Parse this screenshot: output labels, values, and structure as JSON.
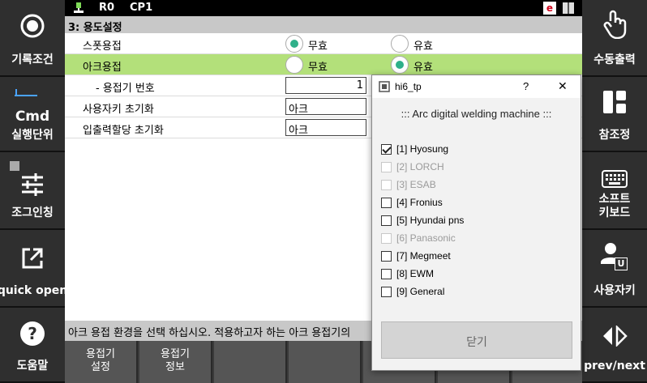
{
  "topbar": {
    "robot": "R0",
    "program": "CP1",
    "e_badge": "e"
  },
  "left_menu": {
    "recording": "기록조건",
    "cmd": "Cmd",
    "exec_unit": "실행단위",
    "jogging": "조그인칭",
    "quick_open": "quick open",
    "help": "도움말"
  },
  "right_menu": {
    "manual_output": "수동출력",
    "reference": "참조정",
    "soft_kb_1": "소프트",
    "soft_kb_2": "키보드",
    "user_key": "사용자키",
    "prev_next": "prev/next",
    "user_badge": "U"
  },
  "main": {
    "title": "3: 용도설정",
    "rows": [
      {
        "name": "스폿용접",
        "opt1": "무효",
        "opt2": "유효"
      },
      {
        "name": "아크용접",
        "opt1": "무효",
        "opt2": "유효"
      },
      {
        "name": "- 용접기 번호",
        "value": "1"
      },
      {
        "name": "사용자키 초기화",
        "value": "아크"
      },
      {
        "name": "입출력할당 초기화",
        "value": "아크"
      }
    ]
  },
  "status_text": "아크 용접 환경을 선택 하십시오.  적용하고자 하는 아크 용접기의",
  "fkeys": {
    "f1_l1": "용접기",
    "f1_l2": "설정",
    "f2_l1": "용접기",
    "f2_l2": "정보"
  },
  "dialog": {
    "title": "hi6_tp",
    "help": "?",
    "close": "✕",
    "heading": "::: Arc digital welding machine :::",
    "options": [
      {
        "label": "[1] Hyosung",
        "checked": true,
        "enabled": true
      },
      {
        "label": "[2] LORCH",
        "checked": false,
        "enabled": false
      },
      {
        "label": "[3] ESAB",
        "checked": false,
        "enabled": false
      },
      {
        "label": "[4] Fronius",
        "checked": false,
        "enabled": true
      },
      {
        "label": "[5] Hyundai pns",
        "checked": false,
        "enabled": true
      },
      {
        "label": "[6] Panasonic",
        "checked": false,
        "enabled": false
      },
      {
        "label": "[7] Megmeet",
        "checked": false,
        "enabled": true
      },
      {
        "label": "[8] EWM",
        "checked": false,
        "enabled": true
      },
      {
        "label": "[9] General",
        "checked": false,
        "enabled": true
      }
    ],
    "close_button": "닫기"
  },
  "colors": {
    "highlight": "#b3e07a",
    "radio_on": "#2fb08a",
    "badge_red": "#d0021b"
  }
}
